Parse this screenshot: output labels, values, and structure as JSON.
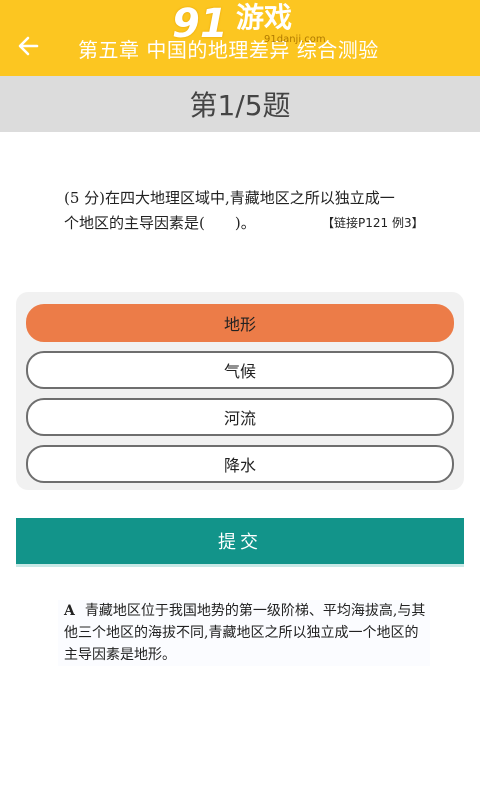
{
  "header": {
    "title": "第五章 中国的地理差异 综合测验",
    "back_icon": "arrow-left-icon",
    "background_color": "#fcc621",
    "watermark": {
      "number": "91",
      "text": "游戏",
      "url": "91danji.com"
    }
  },
  "question_bar": {
    "label": "第1/5题"
  },
  "question": {
    "line1": "(5 分)在四大地理区域中,青藏地区之所以独立成一",
    "line2": "个地区的主导因素是(　　)。",
    "link": "【链接P121 例3】"
  },
  "options": {
    "items": [
      {
        "label": "地形",
        "selected": true
      },
      {
        "label": "气候",
        "selected": false
      },
      {
        "label": "河流",
        "selected": false
      },
      {
        "label": "降水",
        "selected": false
      }
    ],
    "selected_color": "#ec7c48"
  },
  "submit": {
    "label": "提交",
    "color": "#12948a"
  },
  "answer": {
    "letter": "A",
    "line1": "青藏地区位于我国地势的第一级阶梯、平均海拔高,与其",
    "line2": "他三个地区的海拔不同,青藏地区之所以独立成一个地区的",
    "line3": "主导因素是地形。"
  }
}
